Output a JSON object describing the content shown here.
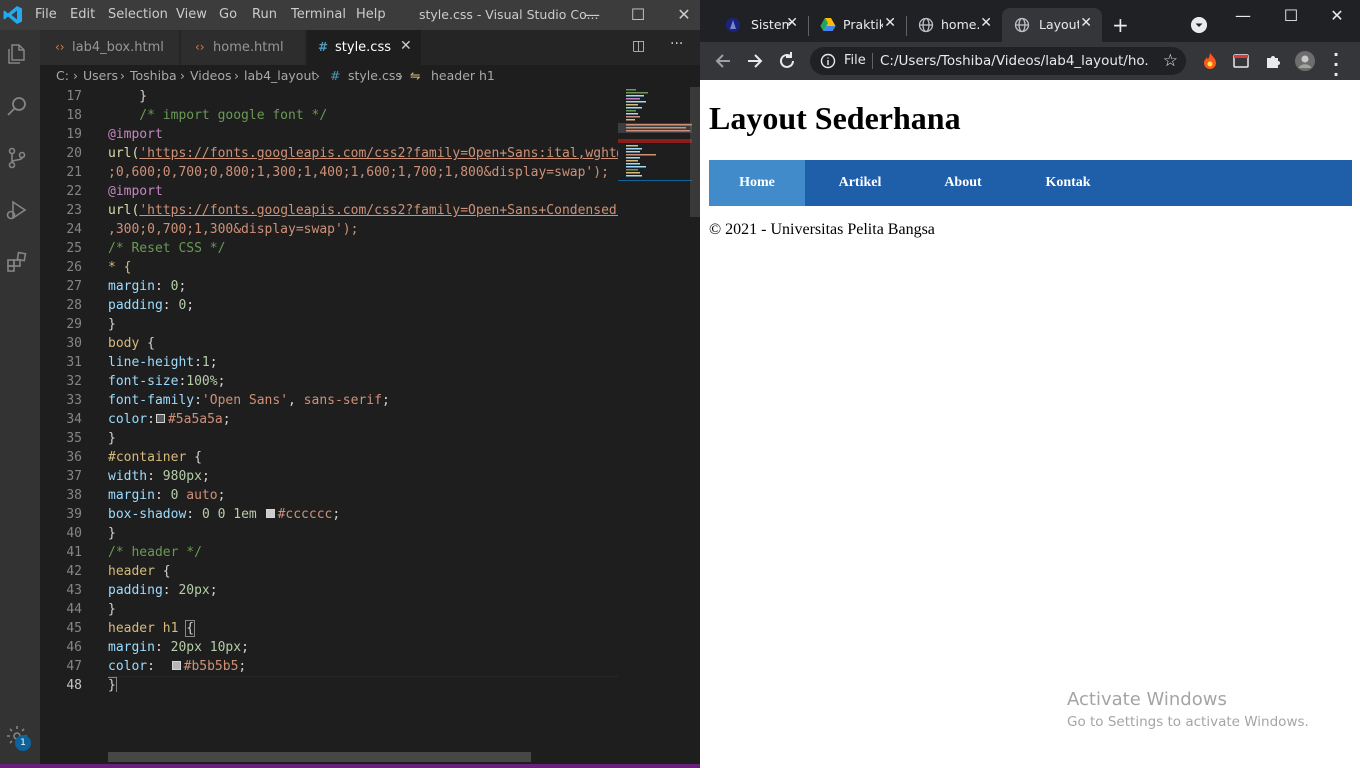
{
  "vscode": {
    "menu": [
      "File",
      "Edit",
      "Selection",
      "View",
      "Go",
      "Run",
      "Terminal",
      "Help"
    ],
    "window_title": "style.css - Visual Studio Co...",
    "tabs": [
      {
        "label": "lab4_box.html",
        "icon": "html-file-icon",
        "active": false
      },
      {
        "label": "home.html",
        "icon": "html-file-icon",
        "active": false
      },
      {
        "label": "style.css",
        "icon": "css-file-icon",
        "active": true
      }
    ],
    "breadcrumb": [
      "C:",
      "Users",
      "Toshiba",
      "Videos",
      "lab4_layout",
      "style.css",
      "header h1"
    ],
    "badge_count": "1",
    "line_numbers": [
      "17",
      "18",
      "19",
      "20",
      "21",
      "22",
      "23",
      "24",
      "25",
      "26",
      "27",
      "28",
      "29",
      "30",
      "31",
      "32",
      "33",
      "34",
      "35",
      "36",
      "37",
      "38",
      "39",
      "40",
      "41",
      "42",
      "43",
      "44",
      "45",
      "46",
      "47",
      "48"
    ],
    "current_line": "48",
    "code": {
      "l17": "    }",
      "l18": "    /* import google font */",
      "l19": "@import",
      "l20_a": "url(",
      "l20_b": "'https://fonts.googleapis.com/css2?family=Open+Sans:ital,wght@",
      "l21": ";0,600;0,700;0,800;1,300;1,400;1,600;1,700;1,800&display=swap');",
      "l22": "@import",
      "l23_a": "url(",
      "l23_b": "'https://fonts.googleapis.com/css2?family=Open+Sans+Condensed:",
      "l24": ",300;0,700;1,300&display=swap');",
      "l25": "/* Reset CSS */",
      "l26": "* {",
      "l27_p": "margin",
      "l27_v": "0",
      "l28_p": "padding",
      "l28_v": "0",
      "l29": "}",
      "l30_s": "body",
      "l31_p": "line-height",
      "l31_v": "1",
      "l32_p": "font-size",
      "l32_v": "100%",
      "l33_p": "font-family",
      "l33_v1": "'Open Sans'",
      "l33_v2": "sans-serif",
      "l34_p": "color",
      "l34_v": "#5a5a5a",
      "l35": "}",
      "l36_s": "#container",
      "l37_p": "width",
      "l37_v": "980px",
      "l38_p": "margin",
      "l38_v1": "0",
      "l38_v2": "auto",
      "l39_p": "box-shadow",
      "l39_v": "0 0 1em",
      "l39_c": "#cccccc",
      "l40": "}",
      "l41": "/* header */",
      "l42_s": "header",
      "l43_p": "padding",
      "l43_v": "20px",
      "l44": "}",
      "l45_s": "header h1",
      "l46_p": "margin",
      "l46_v": "20px 10px",
      "l47_p": "color",
      "l47_v": "#b5b5b5",
      "l48": "}"
    },
    "colors": {
      "swatch_5a5a5a": "#5a5a5a",
      "swatch_cccccc": "#cccccc",
      "swatch_b5b5b5": "#b5b5b5"
    }
  },
  "chrome": {
    "tabs": [
      {
        "title": "Sistem",
        "icon": "site-logo-icon",
        "active": false
      },
      {
        "title": "Praktik",
        "icon": "google-drive-icon",
        "active": false
      },
      {
        "title": "home.",
        "icon": "globe-icon",
        "active": false
      },
      {
        "title": "Layout",
        "icon": "globe-icon",
        "active": true
      }
    ],
    "new_tab": "+",
    "url_scheme": "File",
    "url": "C:/Users/Toshiba/Videos/lab4_layout/ho..."
  },
  "page": {
    "title": "Layout Sederhana",
    "nav": [
      "Home",
      "Artikel",
      "About",
      "Kontak"
    ],
    "footer": "© 2021 - Universitas Pelita Bangsa",
    "nav_color": "#1f5faa",
    "nav_active_color": "#428bca"
  },
  "watermark": {
    "title": "Activate Windows",
    "subtitle": "Go to Settings to activate Windows."
  }
}
